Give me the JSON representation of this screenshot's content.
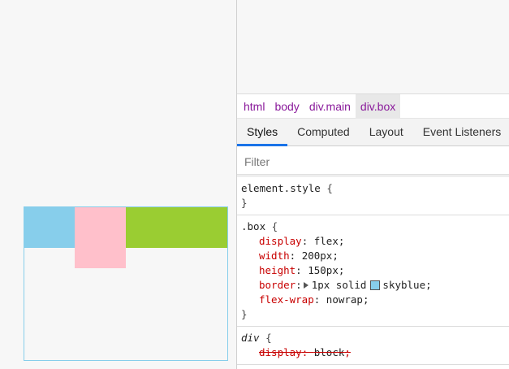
{
  "preview": {
    "border_color": "#87ceeb",
    "children": [
      {
        "color": "#87ceeb"
      },
      {
        "color": "#ffc0cb"
      },
      {
        "color": "#9acd32"
      }
    ]
  },
  "breadcrumbs": [
    "html",
    "body",
    "div.main",
    "div.box"
  ],
  "active_breadcrumb": 3,
  "tabs": [
    "Styles",
    "Computed",
    "Layout",
    "Event Listeners"
  ],
  "active_tab": 0,
  "filter": {
    "placeholder": "Filter"
  },
  "rules": {
    "element_style": {
      "selector": "element.style",
      "open": "{",
      "close": "}"
    },
    "box": {
      "selector": ".box",
      "open": "{",
      "close": "}",
      "decls": [
        {
          "prop": "display",
          "value": "flex"
        },
        {
          "prop": "width",
          "value": "200px"
        },
        {
          "prop": "height",
          "value": "150px"
        },
        {
          "prop": "border",
          "value_a": "1px solid",
          "value_b": "skyblue",
          "swatch": "#87ceeb"
        },
        {
          "prop": "flex-wrap",
          "value": "nowrap"
        }
      ]
    },
    "div": {
      "selector": "div",
      "open": "{",
      "decls": [
        {
          "prop": "display",
          "value": "block"
        }
      ]
    }
  }
}
